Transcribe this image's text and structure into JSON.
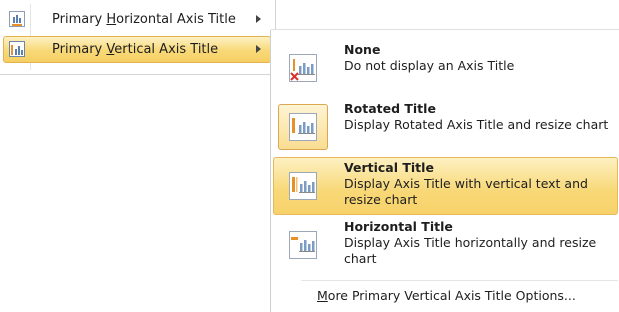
{
  "submenu_parent": {
    "items": [
      {
        "label_pre": "Primary ",
        "label_key": "H",
        "label_post": "orizontal Axis Title",
        "icon": "horizontal-axis-title-icon",
        "selected": false
      },
      {
        "label_pre": "Primary ",
        "label_key": "V",
        "label_post": "ertical Axis Title",
        "icon": "vertical-axis-title-icon",
        "selected": true
      }
    ]
  },
  "options": [
    {
      "title": "None",
      "description": "Do not display an Axis Title",
      "icon": "no-title-icon"
    },
    {
      "title": "Rotated Title",
      "description": "Display Rotated Axis Title and resize chart",
      "icon": "rotated-title-icon"
    },
    {
      "title": "Vertical Title",
      "description": "Display Axis Title with vertical text and resize chart",
      "icon": "vertical-title-icon"
    },
    {
      "title": "Horizontal Title",
      "description": "Display Axis Title horizontally and resize chart",
      "icon": "horizontal-title-icon"
    }
  ],
  "more_options": {
    "key": "M",
    "rest": "ore Primary Vertical Axis Title Options..."
  },
  "colors": {
    "highlight_top": "#fdf0c2",
    "highlight_bottom": "#f7d26b",
    "highlight_border": "#e7b857"
  }
}
